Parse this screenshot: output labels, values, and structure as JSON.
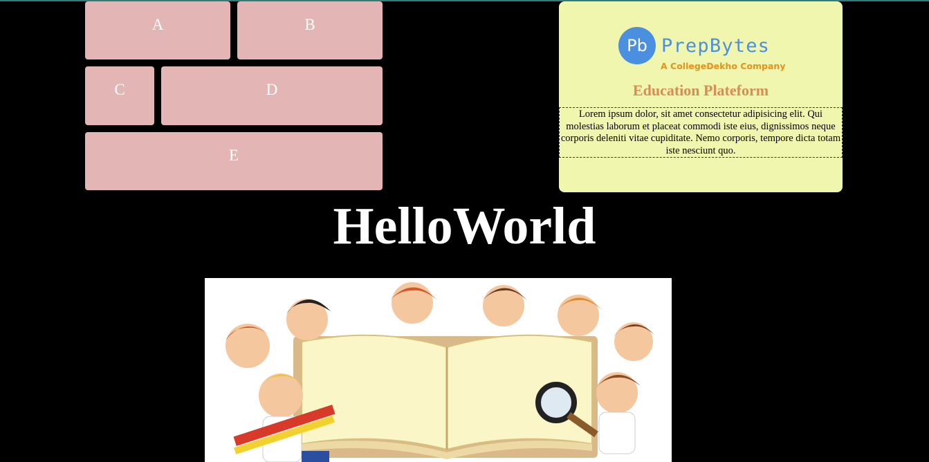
{
  "tiles": {
    "a": "A",
    "b": "B",
    "c": "C",
    "d": "D",
    "e": "E"
  },
  "card": {
    "logo_mark": "Pb",
    "logo_name": "PrepBytes",
    "logo_tagline": "A CollegeDekho Company",
    "title": "Education Plateform",
    "body": "Lorem ipsum dolor, sit amet consectetur adipisicing elit. Qui molestias laborum et placeat commodi iste eius, dignissimos neque corporis deleniti vitae cupiditate. Nemo corporis, tempore dicta totam iste nesciunt quo."
  },
  "hero": {
    "title": "HelloWorld"
  },
  "colors": {
    "page_background": "#000000",
    "tile_background": "#e4b5b5",
    "card_background": "#f0f6ad",
    "brand_blue": "#4a8fe0",
    "brand_orange": "#e8911b",
    "card_title": "#d98b56"
  }
}
